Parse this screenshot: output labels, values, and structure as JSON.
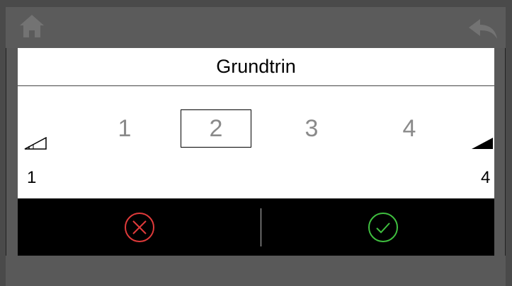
{
  "dialog": {
    "title": "Grundtrin",
    "levels": [
      "1",
      "2",
      "3",
      "4"
    ],
    "selected_level": "2",
    "range_min": "1",
    "range_max": "4"
  },
  "icons": {
    "home": "home-icon",
    "back": "back-arrow-icon",
    "signal_low": "signal-low-icon",
    "signal_high": "signal-high-icon",
    "cancel": "cancel-x-circle-icon",
    "confirm": "confirm-check-circle-icon"
  },
  "colors": {
    "cancel": "#e03a3a",
    "confirm": "#3fbf3f",
    "topbar": "#5b5b5b",
    "actionbar": "#000000"
  }
}
